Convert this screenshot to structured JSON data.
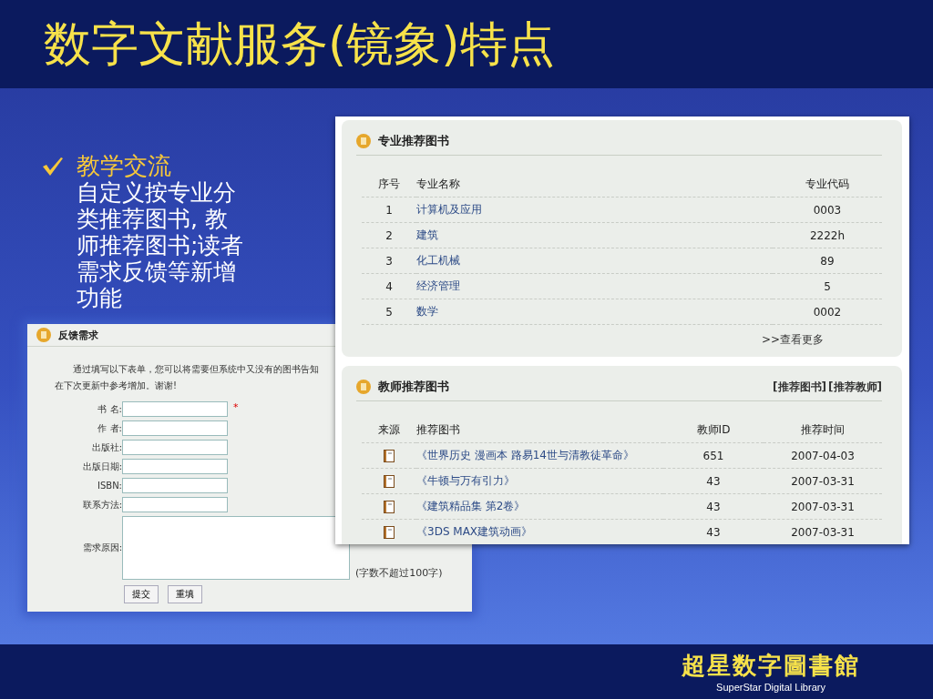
{
  "slide_title": "数字文献服务(镜象)特点",
  "bullet": {
    "heading": "教学交流",
    "text": "自定义按专业分类推荐图书, 教师推荐图书;读者需求反馈等新增功能"
  },
  "feedback_panel": {
    "title": "反馈需求",
    "intro_lines": [
      "通过填写以下表单，您可以将需要但系统中又没有的图书告知",
      "在下次更新中参考增加。谢谢!"
    ],
    "fields": [
      {
        "label": "书 名:",
        "kind": "input",
        "marker": "*"
      },
      {
        "label": "作 者:",
        "kind": "input"
      },
      {
        "label": "出版社:",
        "kind": "input"
      },
      {
        "label": "出版日期:",
        "kind": "input"
      },
      {
        "label": "ISBN:",
        "kind": "input"
      },
      {
        "label": "联系方法:",
        "kind": "input"
      },
      {
        "label": "需求原因:",
        "kind": "textarea",
        "note": "(字数不超过100字)"
      }
    ],
    "buttons": [
      "提交",
      "重填"
    ]
  },
  "major_panel": {
    "title": "专业推荐图书",
    "columns": [
      "序号",
      "专业名称",
      "专业代码"
    ],
    "rows": [
      {
        "no": "1",
        "name": "计算机及应用",
        "code": "0003"
      },
      {
        "no": "2",
        "name": "建筑",
        "code": "2222h"
      },
      {
        "no": "3",
        "name": "化工机械",
        "code": "89"
      },
      {
        "no": "4",
        "name": "经济管理",
        "code": "5"
      },
      {
        "no": "5",
        "name": "数学",
        "code": "0002"
      }
    ],
    "more_link": ">>查看更多"
  },
  "teacher_panel": {
    "title": "教师推荐图书",
    "header_links": [
      "[推荐图书]",
      "[推荐教师]"
    ],
    "columns": [
      "来源",
      "推荐图书",
      "教师ID",
      "推荐时间"
    ],
    "rows": [
      {
        "book": "《世界历史 漫画本 路易14世与清教徒革命》",
        "teacher_id": "651",
        "date": "2007-04-03"
      },
      {
        "book": "《牛顿与万有引力》",
        "teacher_id": "43",
        "date": "2007-03-31"
      },
      {
        "book": "《建筑精品集 第2卷》",
        "teacher_id": "43",
        "date": "2007-03-31"
      },
      {
        "book": "《3DS MAX建筑动画》",
        "teacher_id": "43",
        "date": "2007-03-31"
      }
    ]
  },
  "logo": {
    "name": "超星数字圖書館",
    "subtitle": "SuperStar Digital Library"
  }
}
